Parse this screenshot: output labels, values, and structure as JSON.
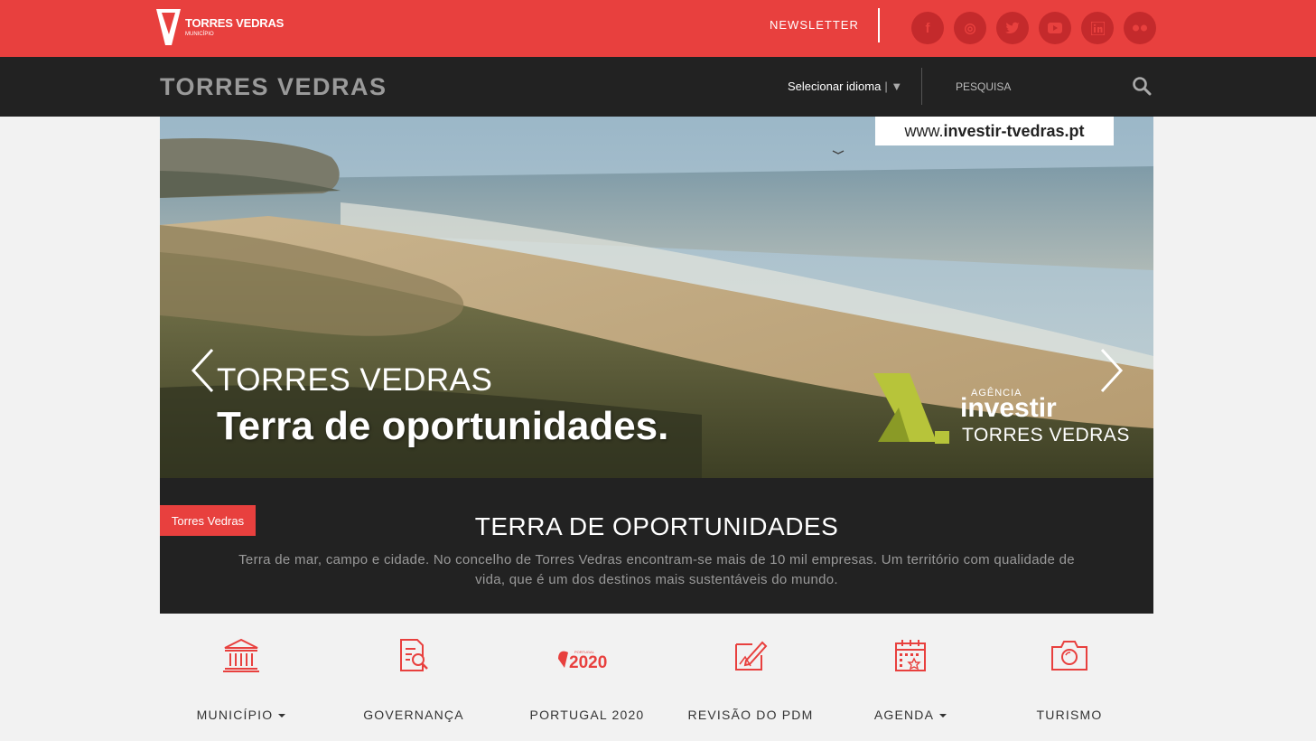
{
  "header": {
    "logo_name": "TORRES VEDRAS",
    "logo_sub": "MUNICÍPIO",
    "newsletter": "NEWSLETTER",
    "socials": [
      {
        "name": "facebook-icon",
        "glyph": "f"
      },
      {
        "name": "instagram-icon",
        "glyph": "◎"
      },
      {
        "name": "twitter-icon",
        "glyph": "🐦"
      },
      {
        "name": "youtube-icon",
        "glyph": "▶"
      },
      {
        "name": "linkedin-icon",
        "glyph": "in"
      },
      {
        "name": "flickr-icon",
        "glyph": "••"
      }
    ]
  },
  "nav": {
    "brand": "TORRES VEDRAS",
    "language": "Selecionar idioma",
    "language_arrow": "| ▼",
    "search_placeholder": "PESQUISA"
  },
  "hero": {
    "url_prefix": "www.",
    "url_bold": "investir-tvedras.pt",
    "line1": "TORRES VEDRAS",
    "line2": "Terra de oportunidades.",
    "agency_small": "AGÊNCIA",
    "agency_big": "investir",
    "agency_sub": "TORRES VEDRAS"
  },
  "caption": {
    "tag": "Torres Vedras",
    "title": "TERRA DE OPORTUNIDADES",
    "text": "Terra de mar, campo e cidade. No concelho de Torres Vedras encontram-se mais de 10 mil empresas. Um território com qualidade de vida, que é um dos destinos mais sustentáveis do mundo."
  },
  "quick_links": [
    {
      "label": "MUNICÍPIO",
      "icon": "building-icon",
      "dropdown": true
    },
    {
      "label": "GOVERNANÇA",
      "icon": "document-search-icon",
      "dropdown": false
    },
    {
      "label": "PORTUGAL 2020",
      "icon": "portugal-2020-logo",
      "dropdown": false
    },
    {
      "label": "REVISÃO DO PDM",
      "icon": "pdm-edit-icon",
      "dropdown": false
    },
    {
      "label": "AGENDA",
      "icon": "calendar-icon",
      "dropdown": true
    },
    {
      "label": "TURISMO",
      "icon": "camera-icon",
      "dropdown": false
    }
  ],
  "colors": {
    "accent": "#e8403e",
    "dark": "#222222",
    "page_bg": "#f2f2f2"
  }
}
